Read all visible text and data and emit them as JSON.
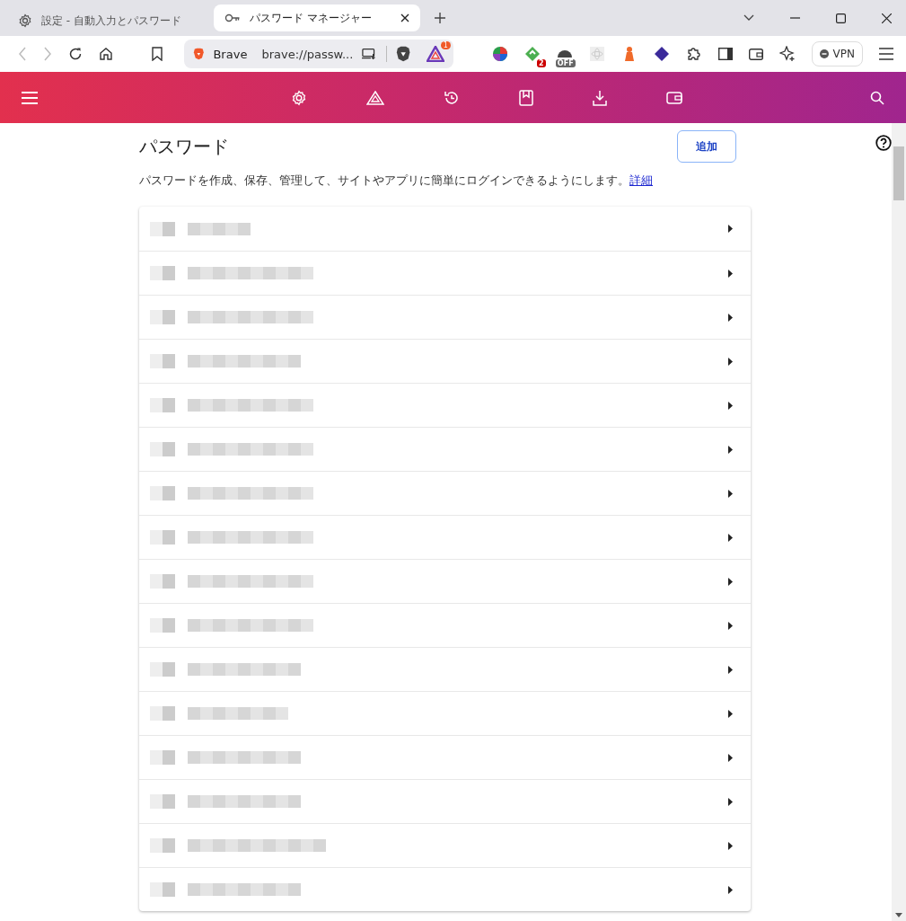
{
  "tabs": [
    {
      "title": "設定 - 自動入力とパスワード",
      "selected": false
    },
    {
      "title": "パスワード マネージャー",
      "selected": true
    }
  ],
  "address_bar": {
    "site_label": "Brave",
    "url": "brave://passw..."
  },
  "extension_badges": [
    "2",
    "OFF"
  ],
  "rewards_badge": "1",
  "vpn_label": "VPN",
  "page": {
    "title": "パスワード",
    "add_button": "追加",
    "description": "パスワードを作成、保存、管理して、サイトやアプリに簡単にログインできるようにします。",
    "learn_more": "詳細"
  },
  "rows": [
    {
      "kind": "redacted"
    },
    {
      "kind": "redacted"
    },
    {
      "kind": "redacted"
    },
    {
      "kind": "redacted"
    },
    {
      "kind": "redacted"
    },
    {
      "kind": "redacted"
    },
    {
      "kind": "redacted"
    },
    {
      "kind": "redacted"
    },
    {
      "kind": "redacted"
    },
    {
      "kind": "redacted"
    },
    {
      "kind": "redacted"
    },
    {
      "kind": "redacted"
    },
    {
      "kind": "redacted"
    },
    {
      "kind": "redacted"
    },
    {
      "kind": "redacted"
    },
    {
      "kind": "redacted"
    }
  ]
}
